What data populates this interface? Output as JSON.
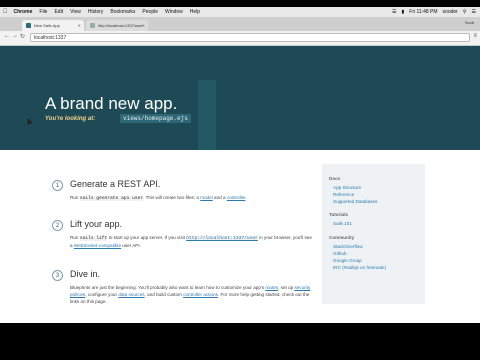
{
  "menubar": {
    "app": "Chrome",
    "items": [
      "File",
      "Edit",
      "View",
      "History",
      "Bookmarks",
      "People",
      "Window",
      "Help"
    ],
    "time": "Fri 11:48 PM",
    "user": "sooder"
  },
  "tabs": [
    {
      "label": "New Sails App"
    },
    {
      "label": "http://localhost:1337/user"
    }
  ],
  "user_chip": "Scott",
  "omnibox": {
    "url": "localhost:1337"
  },
  "hero": {
    "title": "A brand new app.",
    "subtitle": "You're looking at:",
    "code": "views/homepage.ejs"
  },
  "steps": [
    {
      "num": "1",
      "title": "Generate a REST API.",
      "t1": "Run ",
      "c1": "sails generate api user",
      "t2": ". This will create two files: a ",
      "l1": "model",
      "t3": " and a ",
      "l2": "controller",
      "t4": "."
    },
    {
      "num": "2",
      "title": "Lift your app.",
      "t1": "Run ",
      "c1": "sails lift",
      "t2": " to start up your app server. If you visit ",
      "c2": "http://localhost:1337/user",
      "t3": " in your browser, you'll see a ",
      "l1": "WebSocket-compatible",
      "t4": " user API."
    },
    {
      "num": "3",
      "title": "Dive in.",
      "t1": "Blueprints are just the beginning. You'll probably also want to learn how to customize your app's ",
      "l1": "routes",
      "t2": ", set up ",
      "l2": "security policies",
      "t3": ", configure your ",
      "l3": "data sources",
      "t4": ", and build custom ",
      "l4": "controller actions",
      "t5": ". For more help getting started, check out the links on this page."
    }
  ],
  "sidebar": {
    "docs_head": "Docs",
    "docs": [
      "App Structure",
      "Reference",
      "Supported Databases"
    ],
    "tutorials_head": "Tutorials",
    "tutorials": [
      "Sails 101"
    ],
    "community_head": "Community",
    "community": [
      "StackOverflow",
      "Github",
      "Google Group",
      "IRC (#sailsjs on freenode)"
    ]
  }
}
